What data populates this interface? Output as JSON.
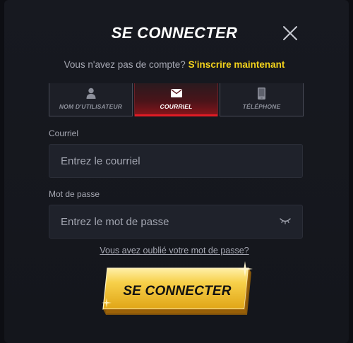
{
  "modal": {
    "title": "SE CONNECTER",
    "close_icon": "close-icon",
    "signup_prompt": "Vous n'avez pas de compte?",
    "signup_link": "S'inscrire maintenant"
  },
  "tabs": [
    {
      "label": "NOM D'UTILISATEUR",
      "icon": "user-icon",
      "active": false
    },
    {
      "label": "COURRIEL",
      "icon": "envelope-icon",
      "active": true
    },
    {
      "label": "TÉLÉPHONE",
      "icon": "phone-icon",
      "active": false
    }
  ],
  "form": {
    "email_label": "Courriel",
    "email_placeholder": "Entrez le courriel",
    "password_label": "Mot de passe",
    "password_placeholder": "Entrez le mot de passe",
    "password_toggle_icon": "eye-closed-icon",
    "forgot_link": "Vous avez oublié votre mot de passe?",
    "submit_label": "SE CONNECTER"
  },
  "colors": {
    "accent_yellow": "#f3d21c",
    "active_tab_red": "#e01c25",
    "button_gold": "#f5c12a"
  }
}
